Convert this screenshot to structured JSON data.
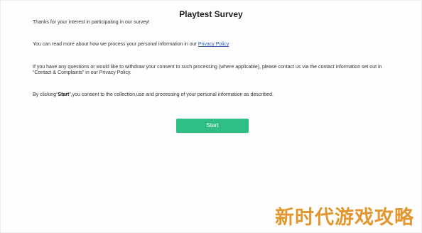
{
  "survey": {
    "title": "Playtest Survey",
    "intro": "Thanks for your interest in participating in our survey!",
    "privacy_prefix": "You can read more about how we process your personal information in our ",
    "privacy_link": "Privacy Policy",
    "withdraw_line1": "If you have any questions or would like to withdraw your consent to such processing (where applicable), please contact us via the contact information set out in",
    "withdraw_line2": "“Contact & Complaints” in our Privacy Policy.",
    "consent_prefix": "By clicking“",
    "consent_bold": "Start",
    "consent_suffix": "”,you consent to the collection,use and processing of your personal information as described.",
    "start_label": "Start"
  },
  "watermark": {
    "text": "新时代游戏攻略"
  },
  "colors": {
    "start_button": "#2fbf86",
    "link": "#2a5db0",
    "watermark": "#e1962e"
  }
}
